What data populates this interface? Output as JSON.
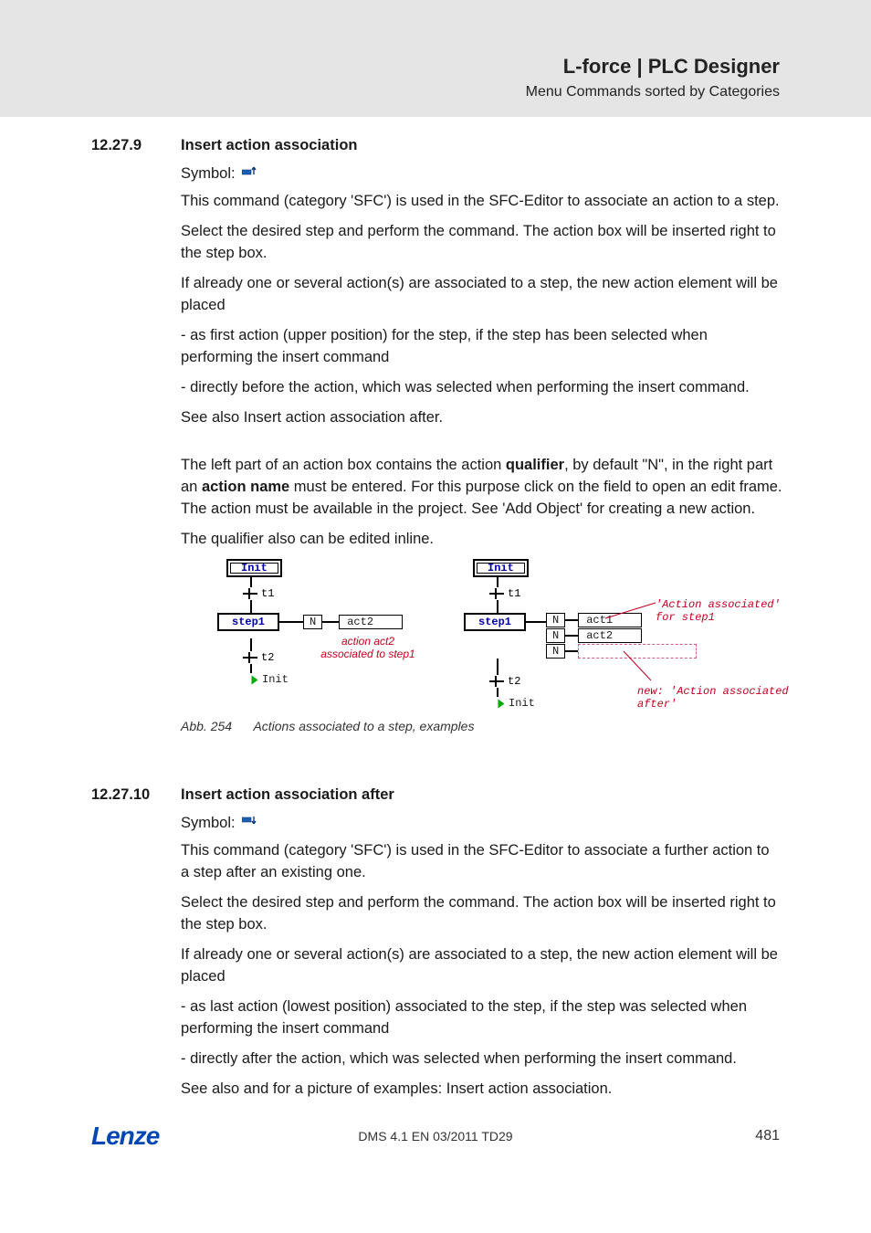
{
  "header": {
    "title": "L-force | PLC Designer",
    "subtitle": "Menu Commands sorted by Categories"
  },
  "section1": {
    "number": "12.27.9",
    "title": "Insert action association",
    "symbol_label": "Symbol:",
    "p1": "This command (category 'SFC') is used in the SFC-Editor to associate an action to a step.",
    "p2": "Select the desired step and perform the command. The action box will be inserted right to the step box.",
    "p3": "If already one or several action(s) are associated to a step, the new action element will be placed",
    "p4": "- as first action (upper position) for the step, if the step has been selected when performing the insert command",
    "p5": "- directly before the action, which was selected when performing the insert command.",
    "p6": "See also Insert action association after.",
    "p7a": "The left part of an action box contains the action ",
    "p7b": "qualifier",
    "p7c": ", by default \"N\", in the right part an ",
    "p7d": "action name",
    "p7e": " must be entered.  For this purpose click on the field to open an edit frame. The action must be available in the project. See 'Add Object' for creating a new action.",
    "p8": "The qualifier also can be edited inline."
  },
  "figure": {
    "abb": "Abb. 254",
    "caption": "Actions associated to a step, examples",
    "left": {
      "init": "Init",
      "t1": "t1",
      "step1": "step1",
      "qual": "N",
      "act": "act2",
      "annot": "action act2 associated to step1",
      "t2": "t2",
      "jump": "Init"
    },
    "right": {
      "init": "Init",
      "t1": "t1",
      "step1": "step1",
      "q1": "N",
      "a1": "act1",
      "q2": "N",
      "a2": "act2",
      "q3": "N",
      "annot_top": "'Action associated' for step1",
      "annot_bot": "new:   'Action associated after'",
      "t2": "t2",
      "jump": "Init"
    }
  },
  "section2": {
    "number": "12.27.10",
    "title": "Insert action association after",
    "symbol_label": "Symbol:",
    "p1": "This command (category 'SFC') is used in the SFC-Editor to associate a further action to a step after an existing one.",
    "p2": "Select the desired step and perform the command. The action box will be inserted right to the step box.",
    "p3": "If already one or several action(s) are associated to a step, the new action element will be placed",
    "p4": "- as last action (lowest position) associated to the step, if the step was selected when performing the insert command",
    "p5": "- directly after the action, which was selected when performing the insert command.",
    "p6": "See also and for a picture of examples: Insert action association."
  },
  "footer": {
    "logo": "Lenze",
    "doc": "DMS 4.1 EN 03/2011 TD29",
    "page": "481"
  }
}
